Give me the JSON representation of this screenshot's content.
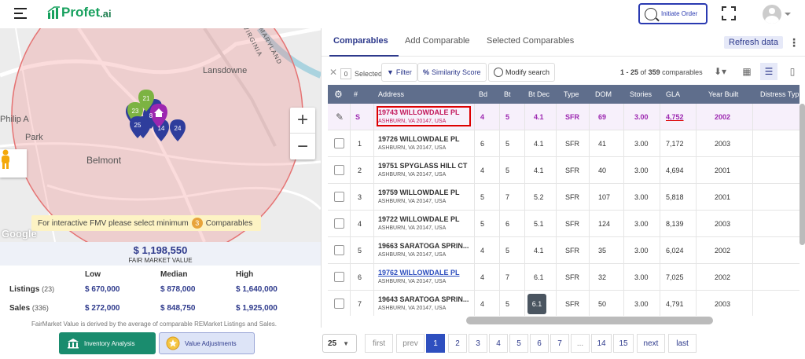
{
  "app": {
    "logo": "Profet",
    "logo_suffix": ".ai"
  },
  "header": {
    "initiate_label": "Initiate Order"
  },
  "map": {
    "labels": {
      "lansdowne": "Lansdowne",
      "belmont": "Belmont",
      "philip": "Philip A",
      "park": "Park",
      "virginia": "VIRGINIA",
      "maryland": "MARYLAND"
    },
    "markers": [
      "21",
      "23",
      "25",
      "14",
      "24",
      "8"
    ],
    "fmv_prompt_prefix": "For interactive FMV please select minimum",
    "fmv_prompt_count": "3",
    "fmv_prompt_suffix": "Comparables",
    "google": "Google"
  },
  "fmv": {
    "value": "$ 1,198,550",
    "label": "FAIR MARKET VALUE",
    "headers": [
      "Low",
      "Median",
      "High"
    ],
    "rows": [
      {
        "label": "Listings",
        "count": "(23)",
        "low": "$ 670,000",
        "median": "$ 878,000",
        "high": "$ 1,640,000"
      },
      {
        "label": "Sales",
        "count": "(336)",
        "low": "$ 272,000",
        "median": "$ 848,750",
        "high": "$ 1,925,000"
      }
    ],
    "note": "FairMarket Value is derived by the average of comparable REMarket Listings and Sales."
  },
  "buttons": {
    "inventory": "Inventory Analysis",
    "value_adjustments": "Value Adjustments"
  },
  "tabs": {
    "comparables": "Comparables",
    "add": "Add Comparable",
    "selected": "Selected Comparables",
    "refresh": "Refresh data",
    "more": "⋮"
  },
  "toolbar": {
    "selected_count": "0",
    "selected_label": "Selected",
    "filter": "Filter",
    "similarity": "Similarity Score",
    "modify": "Modify search",
    "range": "1 - 25",
    "of": "of",
    "total": "359",
    "unit": "comparables"
  },
  "table": {
    "headers": {
      "num": "#",
      "address": "Address",
      "bd": "Bd",
      "bt": "Bt",
      "btdec": "Bt Dec",
      "type": "Type",
      "dom": "DOM",
      "stories": "Stories",
      "gla": "GLA",
      "year": "Year Built",
      "distress": "Distress Typ"
    },
    "subject": {
      "num": "S",
      "street": "19743 WILLOWDALE PL",
      "city": "ASHBURN, VA 20147, USA",
      "bd": "4",
      "bt": "5",
      "btdec": "4.1",
      "type": "SFR",
      "dom": "69",
      "stories": "3.00",
      "gla": "4,752",
      "year": "2002"
    },
    "rows": [
      {
        "num": "1",
        "street": "19726 WILLOWDALE PL",
        "city": "ASHBURN, VA 20147, USA",
        "bd": "6",
        "bt": "5",
        "btdec": "4.1",
        "type": "SFR",
        "dom": "41",
        "stories": "3.00",
        "gla": "7,172",
        "year": "2003"
      },
      {
        "num": "2",
        "street": "19751 SPYGLASS HILL CT",
        "city": "ASHBURN, VA 20147, USA",
        "bd": "4",
        "bt": "5",
        "btdec": "4.1",
        "type": "SFR",
        "dom": "40",
        "stories": "3.00",
        "gla": "4,694",
        "year": "2001"
      },
      {
        "num": "3",
        "street": "19759 WILLOWDALE PL",
        "city": "ASHBURN, VA 20147, USA",
        "bd": "5",
        "bt": "7",
        "btdec": "5.2",
        "type": "SFR",
        "dom": "107",
        "stories": "3.00",
        "gla": "5,818",
        "year": "2001"
      },
      {
        "num": "4",
        "street": "19722 WILLOWDALE PL",
        "city": "ASHBURN, VA 20147, USA",
        "bd": "5",
        "bt": "6",
        "btdec": "5.1",
        "type": "SFR",
        "dom": "124",
        "stories": "3.00",
        "gla": "8,139",
        "year": "2003"
      },
      {
        "num": "5",
        "street": "19663 SARATOGA SPRIN...",
        "city": "ASHBURN, VA 20147, USA",
        "bd": "4",
        "bt": "5",
        "btdec": "4.1",
        "type": "SFR",
        "dom": "35",
        "stories": "3.00",
        "gla": "6,024",
        "year": "2002"
      },
      {
        "num": "6",
        "street": "19762 WILLOWDALE PL",
        "city": "ASHBURN, VA 20147, USA",
        "bd": "4",
        "bt": "7",
        "btdec": "6.1",
        "type": "SFR",
        "dom": "32",
        "stories": "3.00",
        "gla": "7,025",
        "year": "2002"
      },
      {
        "num": "7",
        "street": "19643 SARATOGA SPRIN...",
        "city": "ASHBURN, VA 20147, USA",
        "bd": "4",
        "bt": "5",
        "btdec": "6.1",
        "type": "SFR",
        "dom": "50",
        "stories": "3.00",
        "gla": "4,791",
        "year": "2003"
      }
    ]
  },
  "pager": {
    "size": "25",
    "first": "first",
    "prev": "prev",
    "pages": [
      "1",
      "2",
      "3",
      "4",
      "5",
      "6",
      "7",
      "...",
      "14",
      "15"
    ],
    "next": "next",
    "last": "last"
  },
  "colors": {
    "primary": "#2e3a8c",
    "brand": "#16a05d",
    "subject": "#9c27b0",
    "header": "#5f6e8c",
    "marker": "#2e3d9c"
  }
}
